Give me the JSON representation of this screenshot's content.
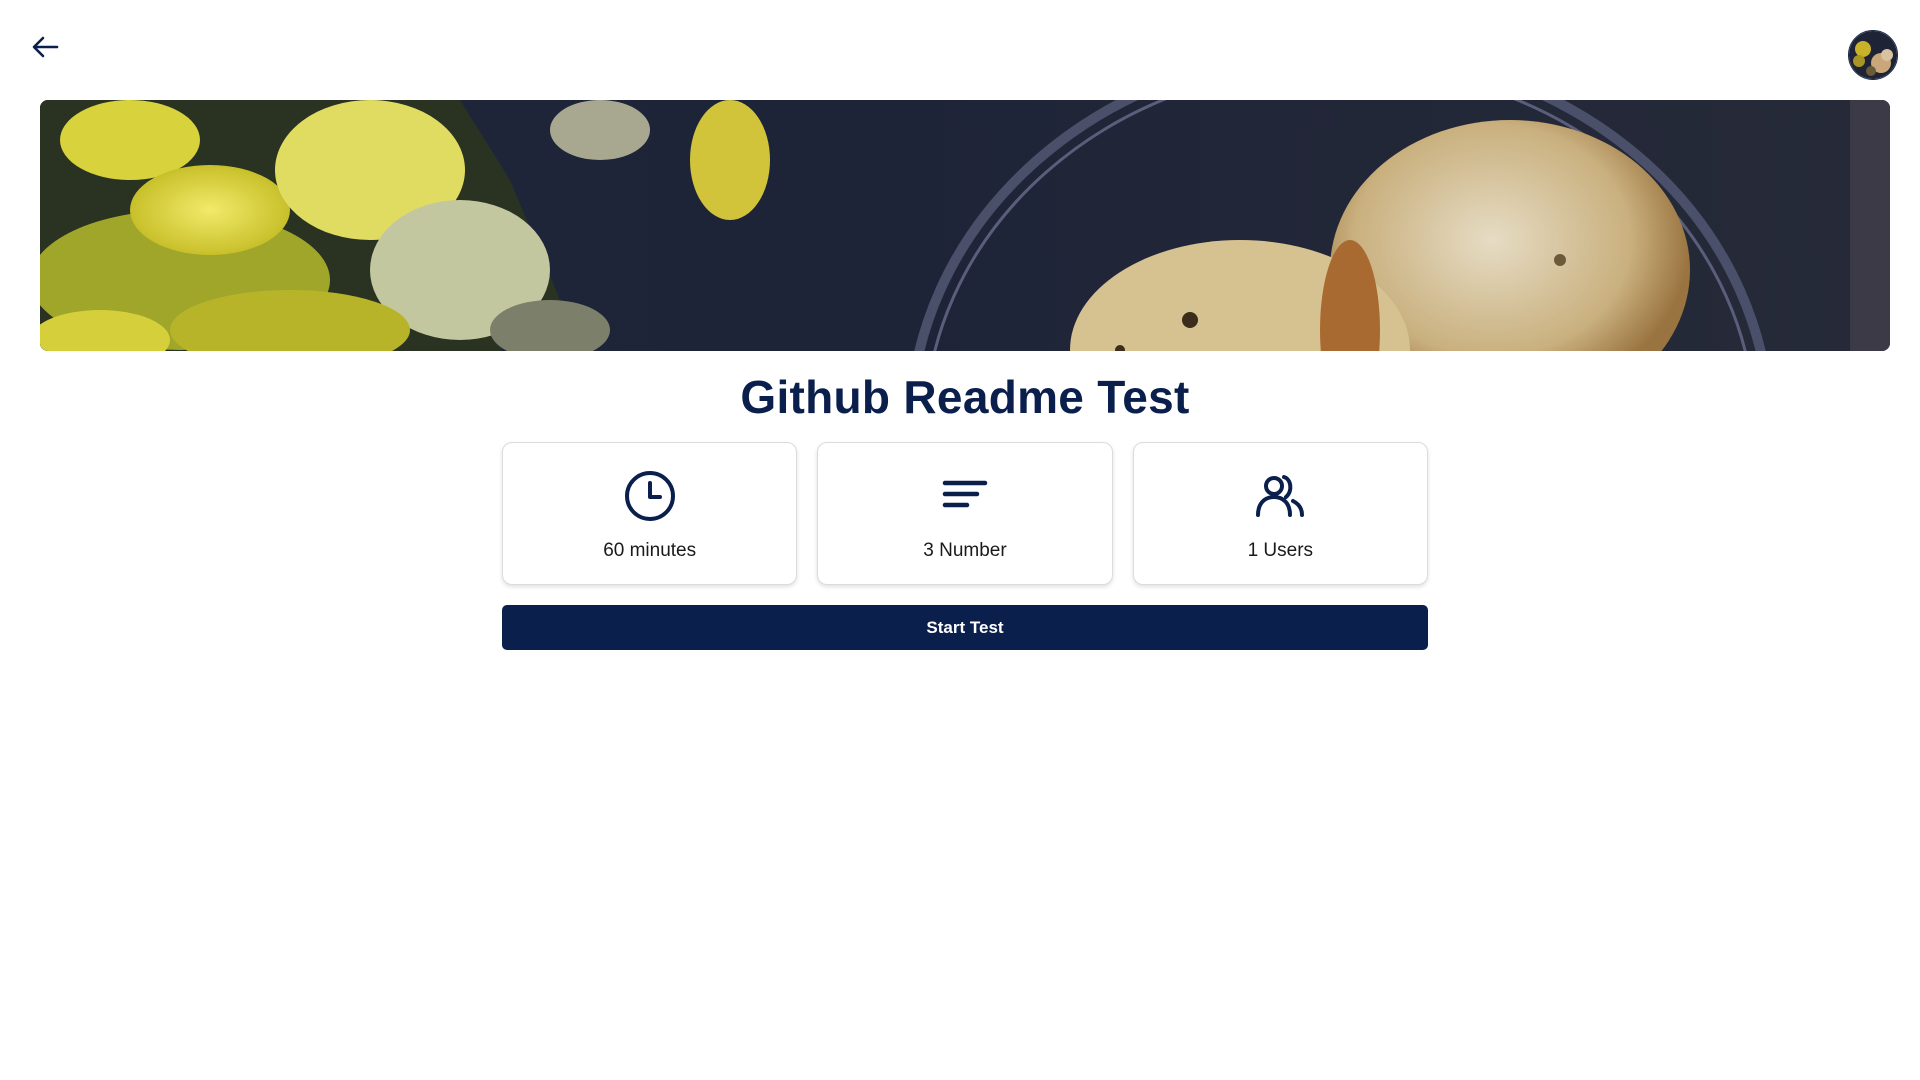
{
  "header": {
    "back_icon": "arrow-left-icon",
    "avatar_icon": "user-avatar"
  },
  "banner": {
    "description_icon": "cover-image"
  },
  "test": {
    "title": "Github Readme Test"
  },
  "stats": [
    {
      "icon": "clock-icon",
      "label": "60 minutes"
    },
    {
      "icon": "sort-lines-icon",
      "label": "3 Number"
    },
    {
      "icon": "users-icon",
      "label": "1 Users"
    }
  ],
  "actions": {
    "start_label": "Start Test"
  },
  "colors": {
    "primary": "#0b1f4d",
    "button_text": "#ffffff",
    "card_border": "#dcdcdc"
  }
}
